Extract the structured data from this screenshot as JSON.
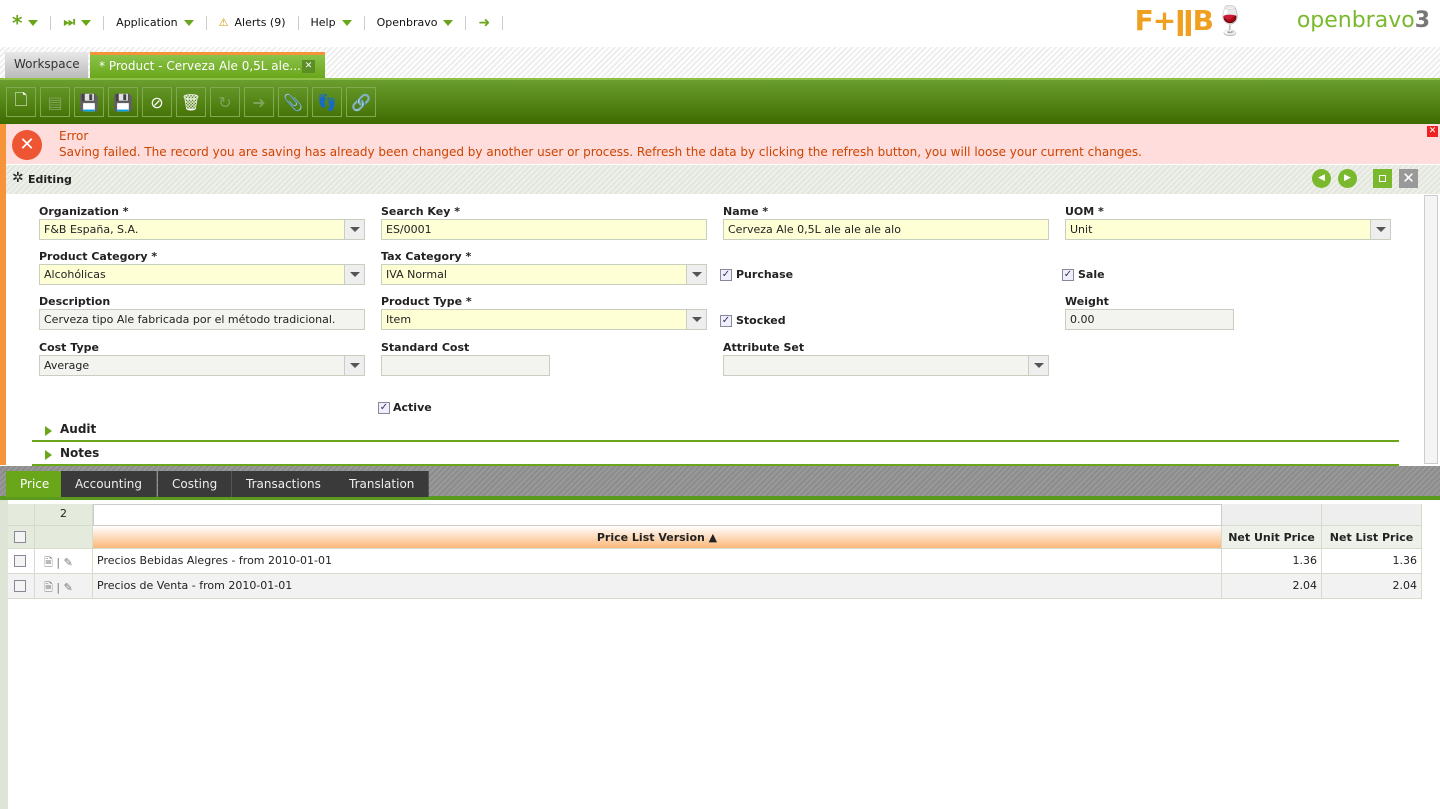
{
  "topbar": {
    "menus": [
      "Application",
      "Alerts (9)",
      "Help",
      "Openbravo"
    ]
  },
  "logos": {
    "brand": "F+B",
    "powered": "powered by openbravo 3 agile erp"
  },
  "tabs": {
    "workspace": "Workspace",
    "active": "* Product - Cerveza Ale 0,5L ale..."
  },
  "toolbar": {
    "buttons": [
      "new",
      "form-view",
      "save",
      "save-close",
      "undo",
      "delete",
      "refresh",
      "export",
      "attach",
      "audit-trail",
      "link"
    ]
  },
  "error": {
    "title": "Error",
    "message": "Saving failed. The record you are saving has already been changed by another user or process. Refresh the data by clicking the refresh button, you will loose your current changes."
  },
  "editing": {
    "title": "Editing"
  },
  "form": {
    "organization": {
      "label": "Organization *",
      "value": "F&B España, S.A."
    },
    "search_key": {
      "label": "Search Key *",
      "value": "ES/0001"
    },
    "name": {
      "label": "Name *",
      "value": "Cerveza Ale 0,5L ale ale ale alo"
    },
    "uom": {
      "label": "UOM *",
      "value": "Unit"
    },
    "product_category": {
      "label": "Product Category *",
      "value": "Alcohólicas"
    },
    "tax_category": {
      "label": "Tax Category *",
      "value": "IVA Normal"
    },
    "purchase": {
      "label": "Purchase",
      "checked": true
    },
    "sale": {
      "label": "Sale",
      "checked": true
    },
    "description": {
      "label": "Description",
      "value": "Cerveza tipo Ale fabricada por el método tradicional."
    },
    "product_type": {
      "label": "Product Type *",
      "value": "Item"
    },
    "stocked": {
      "label": "Stocked",
      "checked": true
    },
    "weight": {
      "label": "Weight",
      "value": "0.00"
    },
    "cost_type": {
      "label": "Cost Type",
      "value": "Average"
    },
    "standard_cost": {
      "label": "Standard Cost",
      "value": ""
    },
    "attribute_set": {
      "label": "Attribute Set",
      "value": ""
    },
    "active": {
      "label": "Active",
      "checked": true
    },
    "sections": [
      "Audit",
      "Notes"
    ]
  },
  "subtabs": [
    "Price",
    "Accounting",
    "Costing",
    "Transactions",
    "Translation"
  ],
  "grid": {
    "count": "2",
    "columns": [
      "Price List Version ▲",
      "Net Unit Price",
      "Net List Price"
    ],
    "rows": [
      [
        "Precios Bebidas Alegres - from 2010-01-01",
        "1.36",
        "1.36"
      ],
      [
        "Precios de Venta - from 2010-01-01",
        "2.04",
        "2.04"
      ]
    ]
  }
}
